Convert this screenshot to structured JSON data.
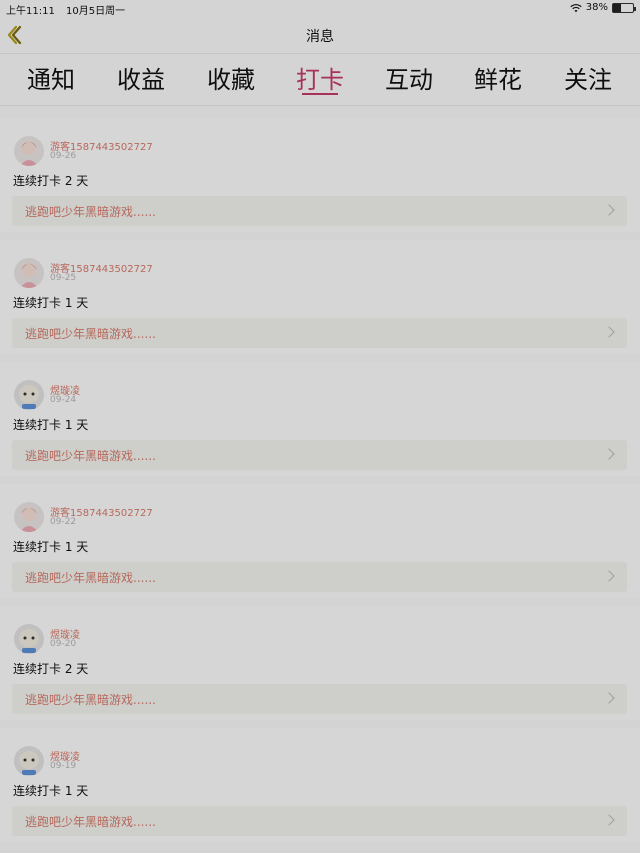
{
  "status_bar": {
    "time": "上午11:11",
    "date": "10月5日周一",
    "battery": "38%",
    "battery_level": 0.38
  },
  "nav": {
    "title": "消息"
  },
  "tabs": [
    {
      "label": "通知"
    },
    {
      "label": "收益"
    },
    {
      "label": "收藏"
    },
    {
      "label": "打卡"
    },
    {
      "label": "互动"
    },
    {
      "label": "鲜花"
    },
    {
      "label": "关注"
    }
  ],
  "active_tab": "打卡",
  "items": [
    {
      "user": "游客1587443502727",
      "date": "09-26",
      "checkin": "连续打卡 2 天",
      "game": "逃跑吧少年黑暗游戏......",
      "avatar": "girl-avatar"
    },
    {
      "user": "游客1587443502727",
      "date": "09-25",
      "checkin": "连续打卡 1 天",
      "game": "逃跑吧少年黑暗游戏......",
      "avatar": "girl-avatar"
    },
    {
      "user": "煜璇凌",
      "date": "09-24",
      "checkin": "连续打卡 1 天",
      "game": "逃跑吧少年黑暗游戏......",
      "avatar": "sheep-avatar"
    },
    {
      "user": "游客1587443502727",
      "date": "09-22",
      "checkin": "连续打卡 1 天",
      "game": "逃跑吧少年黑暗游戏......",
      "avatar": "girl-avatar"
    },
    {
      "user": "煜璇凌",
      "date": "09-20",
      "checkin": "连续打卡 2 天",
      "game": "逃跑吧少年黑暗游戏......",
      "avatar": "sheep-avatar"
    },
    {
      "user": "煜璇凌",
      "date": "09-19",
      "checkin": "连续打卡 1 天",
      "game": "逃跑吧少年黑暗游戏......",
      "avatar": "sheep-avatar"
    }
  ],
  "colors": {
    "accent": "#c33a6a",
    "username": "#d57a6b"
  }
}
